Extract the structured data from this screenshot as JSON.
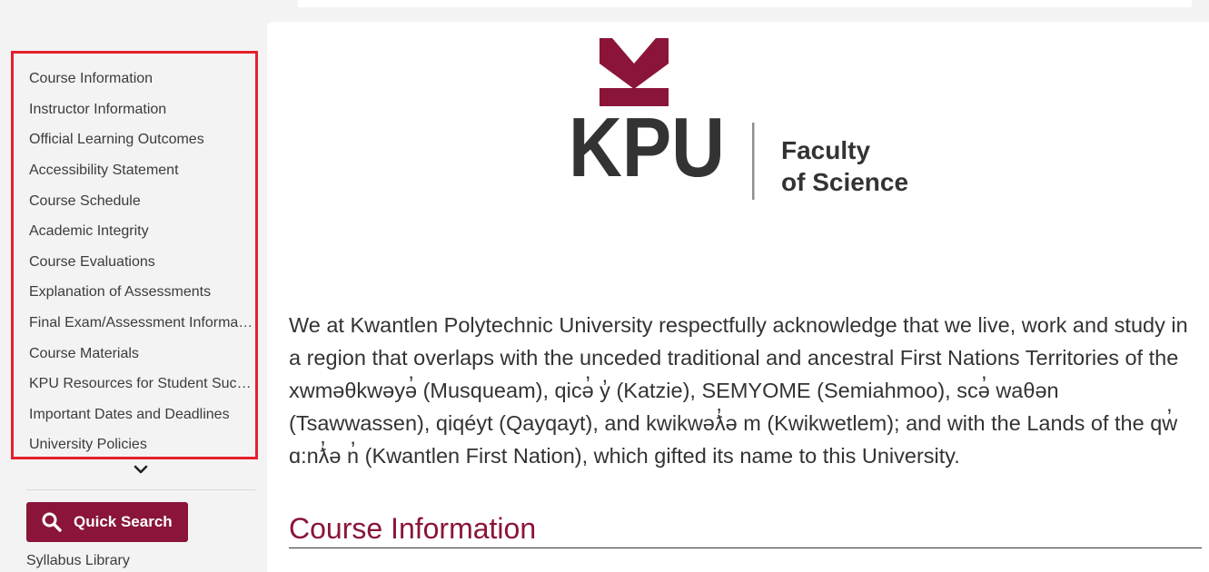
{
  "sidebar": {
    "nav_items": [
      "Course Information",
      "Instructor Information",
      "Official Learning Outcomes",
      "Accessibility Statement",
      "Course Schedule",
      "Academic Integrity",
      "Course Evaluations",
      "Explanation of Assessments",
      "Final Exam/Assessment Information",
      "Course Materials",
      "KPU Resources for Student Success",
      "Important Dates and Deadlines",
      "University Policies"
    ],
    "expand_icon": "chevron-down-icon",
    "quick_search_label": "Quick Search",
    "quick_search_icon": "search-icon",
    "syllabus_library_label": "Syllabus Library"
  },
  "logo": {
    "wordmark": "KPU",
    "faculty_line1": "Faculty",
    "faculty_line2": "of Science"
  },
  "main": {
    "acknowledgement": "We at Kwantlen Polytechnic University respectfully acknowledge that we live, work and study in a region that overlaps with the unceded traditional and ancestral First Nations Territories of the xwməθkwəyə̓ (Musqueam), qicə̓ y̓ (Katzie), SEMYOME (Semiahmoo), scə̓ waθən (Tsawwassen), qiqéyt (Qayqayt), and kwikwəƛ̓ə m (Kwikwetlem); and with the Lands of the qw̓ ɑ:nƛ̓ə n̓ (Kwantlen First Nation), which gifted its name to this University.",
    "section_title": "Course Information"
  },
  "colors": {
    "brand": "#8a1538",
    "highlight_border": "#e3202b",
    "logo_grey": "#333333"
  }
}
